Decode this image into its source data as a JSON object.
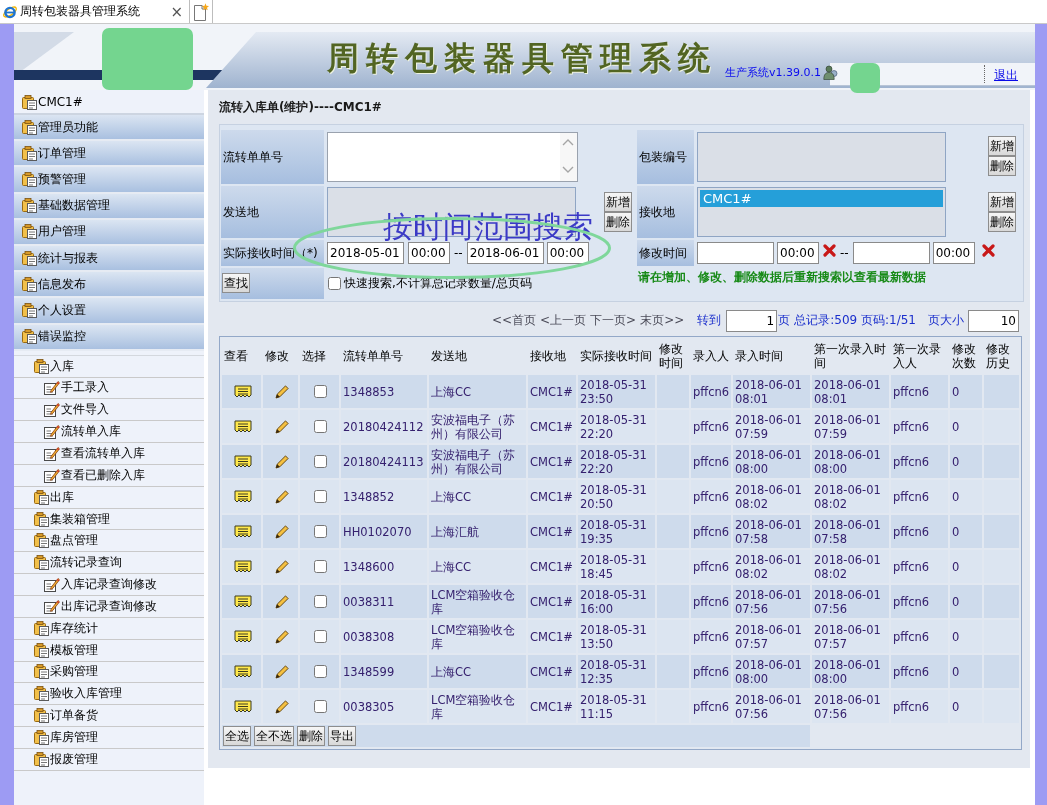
{
  "browser_tab": {
    "title": "周转包装器具管理系统",
    "close": "×"
  },
  "header": {
    "title": "周转包装器具管理系统",
    "version": "生产系统v1.39.0.1",
    "logout": "退出"
  },
  "sidebar": {
    "current": "CMC1#",
    "categories": [
      "管理员功能",
      "订单管理",
      "预警管理",
      "基础数据管理",
      "用户管理",
      "统计与报表",
      "信息发布",
      "个人设置",
      "错误监控"
    ],
    "tree": [
      {
        "label": "入库",
        "kind": "folder",
        "children": [
          {
            "label": "手工录入",
            "kind": "page"
          },
          {
            "label": "文件导入",
            "kind": "page"
          },
          {
            "label": "流转单入库",
            "kind": "page"
          },
          {
            "label": "查看流转单入库",
            "kind": "page"
          },
          {
            "label": "查看已删除入库",
            "kind": "page"
          }
        ]
      },
      {
        "label": "出库",
        "kind": "folder"
      },
      {
        "label": "集装箱管理",
        "kind": "folder"
      },
      {
        "label": "盘点管理",
        "kind": "folder"
      },
      {
        "label": "流转记录查询",
        "kind": "folder",
        "children": [
          {
            "label": "入库记录查询修改",
            "kind": "page"
          },
          {
            "label": "出库记录查询修改",
            "kind": "page"
          }
        ]
      },
      {
        "label": "库存统计",
        "kind": "folder"
      },
      {
        "label": "模板管理",
        "kind": "folder"
      },
      {
        "label": "采购管理",
        "kind": "folder"
      },
      {
        "label": "验收入库管理",
        "kind": "folder"
      },
      {
        "label": "订单备货",
        "kind": "folder"
      },
      {
        "label": "库房管理",
        "kind": "folder"
      },
      {
        "label": "报废管理",
        "kind": "folder"
      }
    ]
  },
  "page_title": "流转入库单(维护)----CMC1#",
  "form": {
    "order_no": {
      "label": "流转单单号"
    },
    "package_no": {
      "label": "包装编号",
      "buttons": [
        "新增",
        "删除"
      ]
    },
    "origin": {
      "label": "发送地",
      "buttons": [
        "新增",
        "删除"
      ]
    },
    "destination": {
      "label": "接收地",
      "options": [
        {
          "label": "CMC1#",
          "selected": true
        }
      ],
      "buttons": [
        "新增",
        "删除"
      ]
    },
    "receive_time": {
      "label": "实际接收时间（*)",
      "from_date": "2018-05-01",
      "from_time": "00:00",
      "separator": "--",
      "to_date": "2018-06-01",
      "to_time": "00:00"
    },
    "modify_time": {
      "label": "修改时间",
      "from_time": "00:00",
      "separator": "--",
      "to_time": "00:00"
    },
    "search_button": "查找",
    "quick_search": {
      "label": "快速搜索,不计算总记录数量/总页码",
      "checked": false
    },
    "notice": "请在增加、修改、删除数据后重新搜索以查看最新数据"
  },
  "annotation": "按时间范围搜索",
  "pagination": {
    "links": [
      "<<首页",
      "<上一页",
      "下一页>",
      "末页>>"
    ],
    "goto_label": "转到",
    "page": "1",
    "page_suffix": "页",
    "summary": "总记录:509 页码:1/51",
    "page_size_label": "页大小",
    "page_size": "10"
  },
  "table": {
    "columns": [
      "查看",
      "修改",
      "选择",
      "流转单单号",
      "发送地",
      "接收地",
      "实际接收时间",
      "修改时间",
      "录入人",
      "录入时间",
      "第一次录入时间",
      "第一次录入人",
      "修改次数",
      "修改历史"
    ],
    "rows": [
      {
        "order_no": "1348853",
        "origin": "上海CC",
        "destination": "CMC1#",
        "receive_time": "2018-05-31 23:50",
        "entered_by": "pffcn6",
        "entry_time": "2018-06-01 08:01",
        "first_entry_time": "2018-06-01 08:01",
        "first_entered_by": "pffcn6",
        "modify_count": "0",
        "selected": false
      },
      {
        "order_no": "20180424112",
        "origin": "安波福电子（苏州）有限公司",
        "destination": "CMC1#",
        "receive_time": "2018-05-31 22:20",
        "entered_by": "pffcn6",
        "entry_time": "2018-06-01 07:59",
        "first_entry_time": "2018-06-01 07:59",
        "first_entered_by": "pffcn6",
        "modify_count": "0",
        "selected": false
      },
      {
        "order_no": "20180424113",
        "origin": "安波福电子（苏州）有限公司",
        "destination": "CMC1#",
        "receive_time": "2018-05-31 22:20",
        "entered_by": "pffcn6",
        "entry_time": "2018-06-01 08:00",
        "first_entry_time": "2018-06-01 08:00",
        "first_entered_by": "pffcn6",
        "modify_count": "0",
        "selected": false
      },
      {
        "order_no": "1348852",
        "origin": "上海CC",
        "destination": "CMC1#",
        "receive_time": "2018-05-31 20:50",
        "entered_by": "pffcn6",
        "entry_time": "2018-06-01 08:02",
        "first_entry_time": "2018-06-01 08:02",
        "first_entered_by": "pffcn6",
        "modify_count": "0",
        "selected": false
      },
      {
        "order_no": "HH0102070",
        "origin": "上海汇航",
        "destination": "CMC1#",
        "receive_time": "2018-05-31 19:35",
        "entered_by": "pffcn6",
        "entry_time": "2018-06-01 07:58",
        "first_entry_time": "2018-06-01 07:58",
        "first_entered_by": "pffcn6",
        "modify_count": "0",
        "selected": false
      },
      {
        "order_no": "1348600",
        "origin": "上海CC",
        "destination": "CMC1#",
        "receive_time": "2018-05-31 18:45",
        "entered_by": "pffcn6",
        "entry_time": "2018-06-01 08:02",
        "first_entry_time": "2018-06-01 08:02",
        "first_entered_by": "pffcn6",
        "modify_count": "0",
        "selected": false
      },
      {
        "order_no": "0038311",
        "origin": "LCM空箱验收仓库",
        "destination": "CMC1#",
        "receive_time": "2018-05-31 16:00",
        "entered_by": "pffcn6",
        "entry_time": "2018-06-01 07:56",
        "first_entry_time": "2018-06-01 07:56",
        "first_entered_by": "pffcn6",
        "modify_count": "0",
        "selected": false
      },
      {
        "order_no": "0038308",
        "origin": "LCM空箱验收仓库",
        "destination": "CMC1#",
        "receive_time": "2018-05-31 13:50",
        "entered_by": "pffcn6",
        "entry_time": "2018-06-01 07:57",
        "first_entry_time": "2018-06-01 07:57",
        "first_entered_by": "pffcn6",
        "modify_count": "0",
        "selected": false
      },
      {
        "order_no": "1348599",
        "origin": "上海CC",
        "destination": "CMC1#",
        "receive_time": "2018-05-31 12:35",
        "entered_by": "pffcn6",
        "entry_time": "2018-06-01 08:00",
        "first_entry_time": "2018-06-01 08:00",
        "first_entered_by": "pffcn6",
        "modify_count": "0",
        "selected": false
      },
      {
        "order_no": "0038305",
        "origin": "LCM空箱验收仓库",
        "destination": "CMC1#",
        "receive_time": "2018-05-31 11:15",
        "entered_by": "pffcn6",
        "entry_time": "2018-06-01 07:56",
        "first_entry_time": "2018-06-01 07:56",
        "first_entered_by": "pffcn6",
        "modify_count": "0",
        "selected": false
      }
    ]
  },
  "table_actions": [
    "全选",
    "全不选",
    "删除",
    "导出"
  ]
}
